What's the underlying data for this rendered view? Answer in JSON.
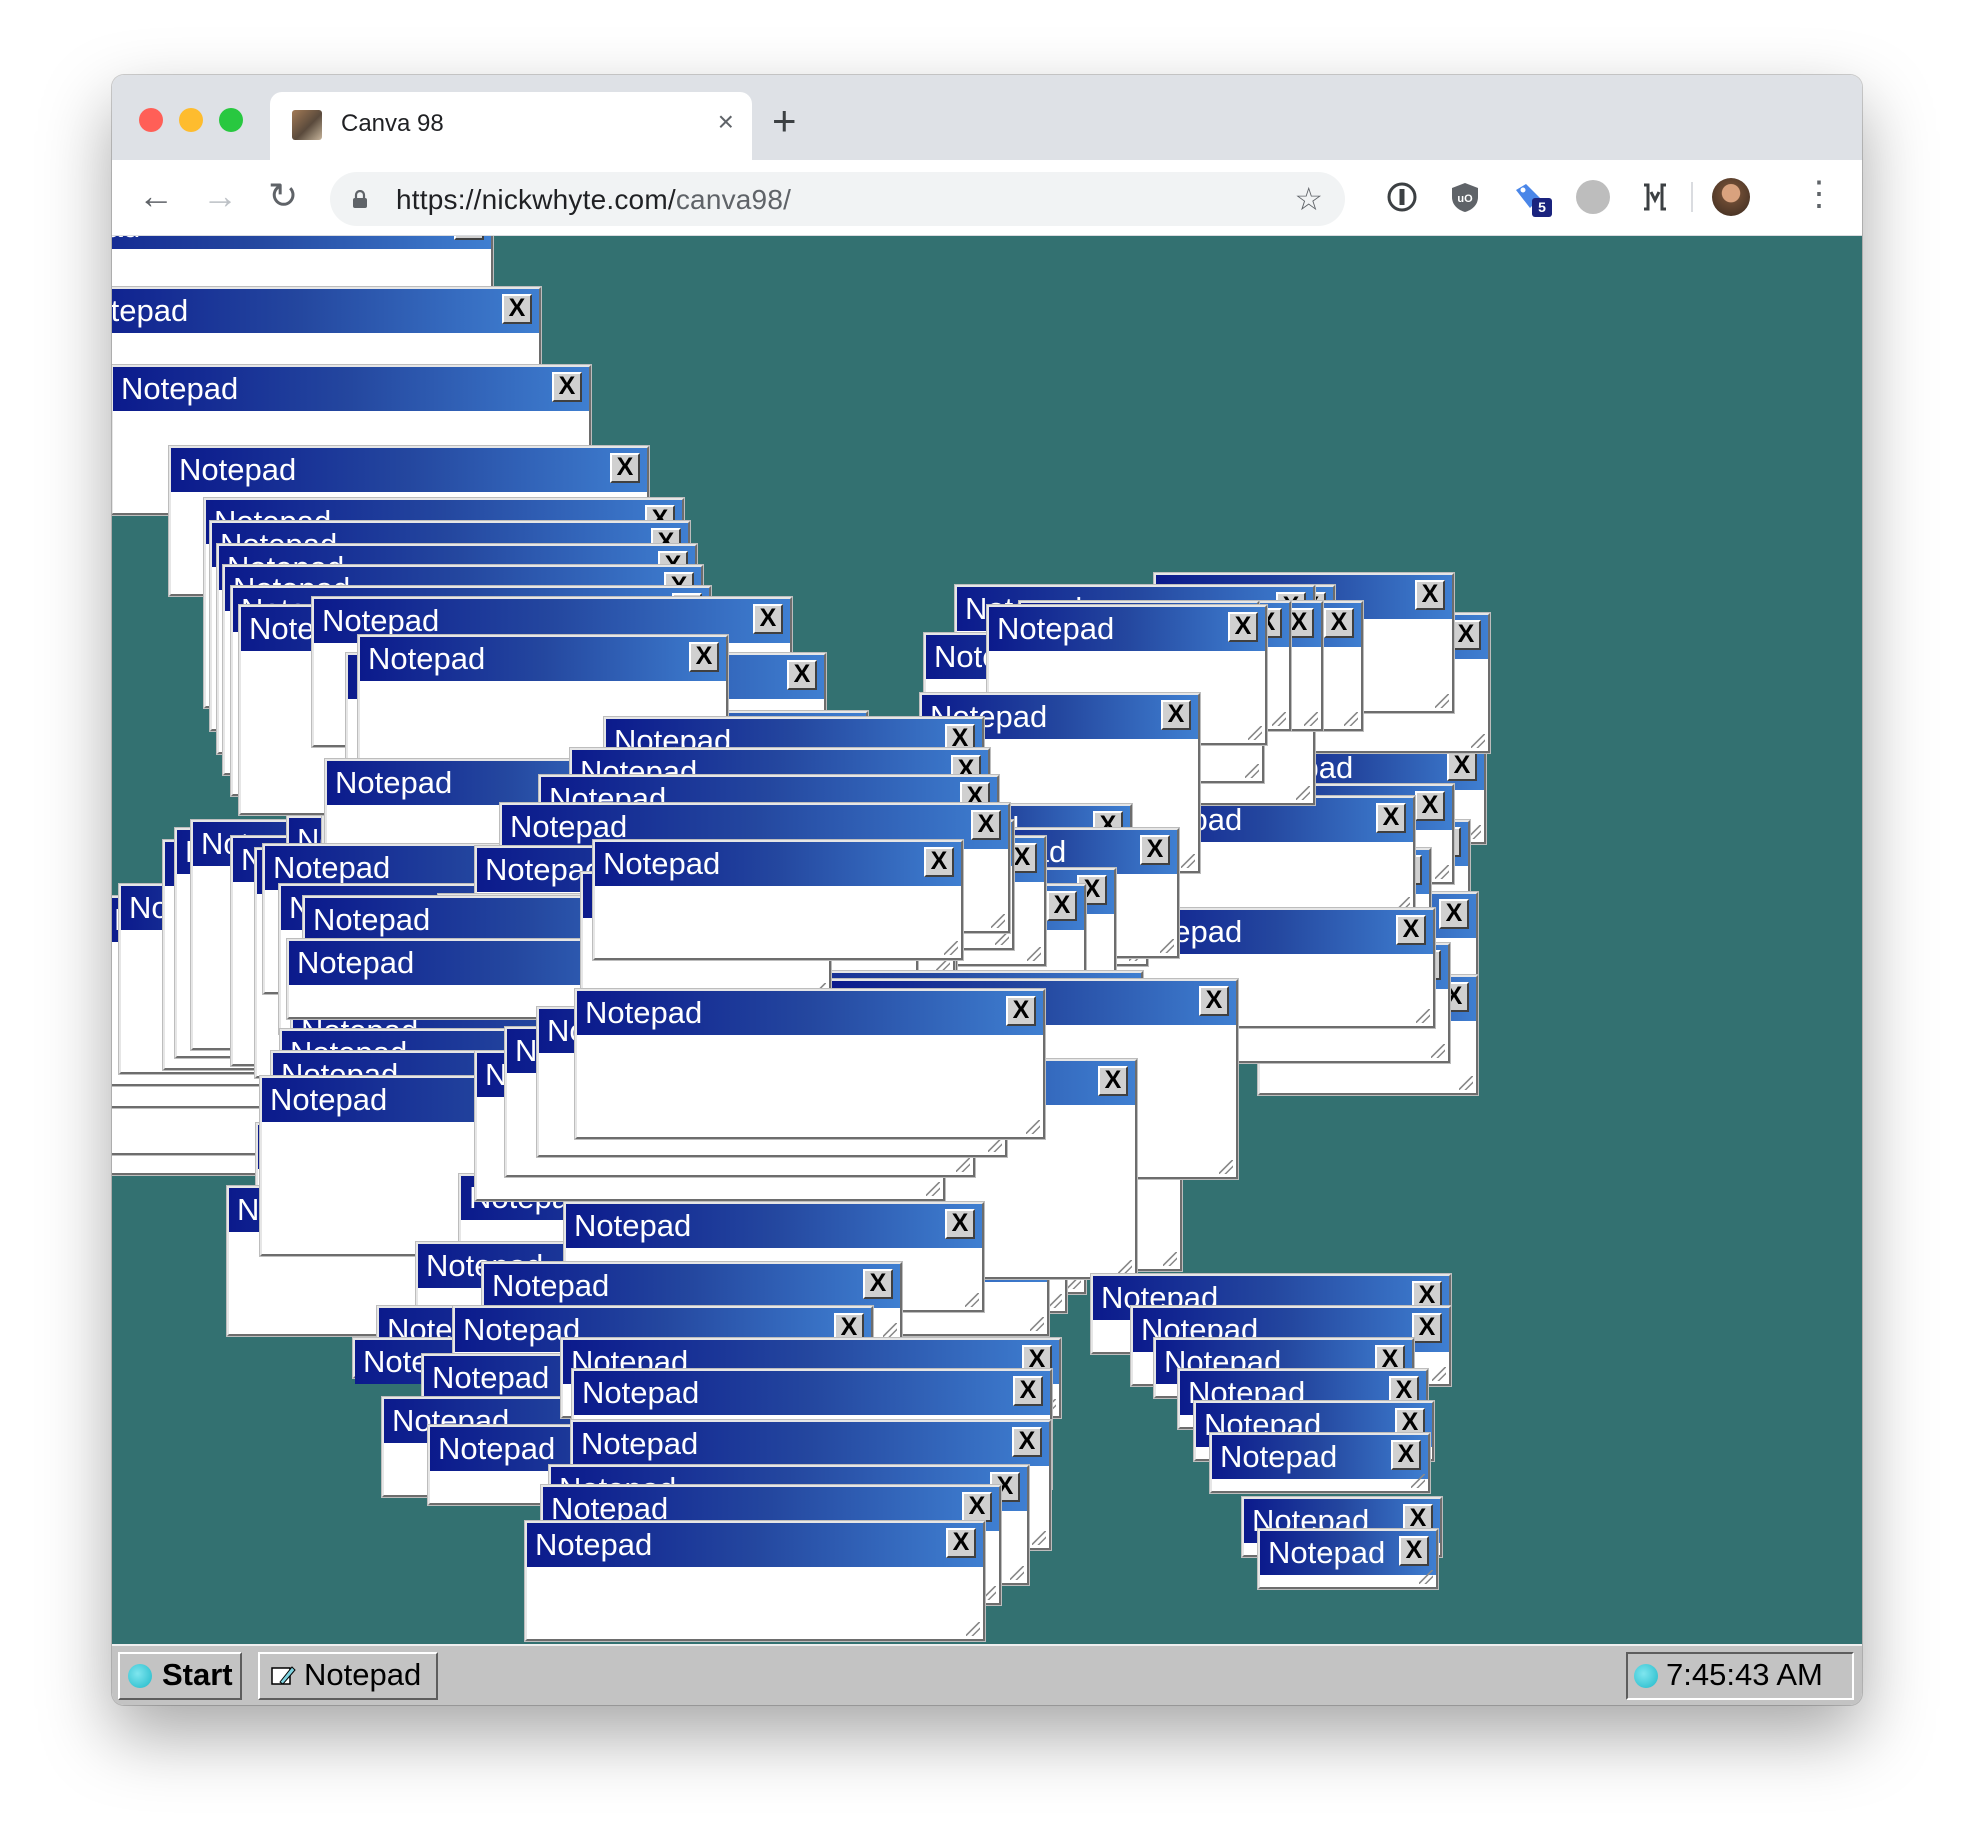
{
  "browser": {
    "tab_title": "Canva 98",
    "tab_close": "×",
    "new_tab": "+",
    "url_host": "https://nickwhyte.com/",
    "url_path": "canva98/",
    "extension_badge": "5",
    "colors": {
      "close": "#ff5f57",
      "minimize": "#febc2e",
      "maximize": "#28c840"
    }
  },
  "desktop": {
    "background": "#337171",
    "window_title": "Notepad",
    "close_label": "X",
    "window_count": 60
  },
  "taskbar": {
    "start_label": "Start",
    "task_label": "Notepad",
    "clock": "7:45:43 AM"
  }
}
